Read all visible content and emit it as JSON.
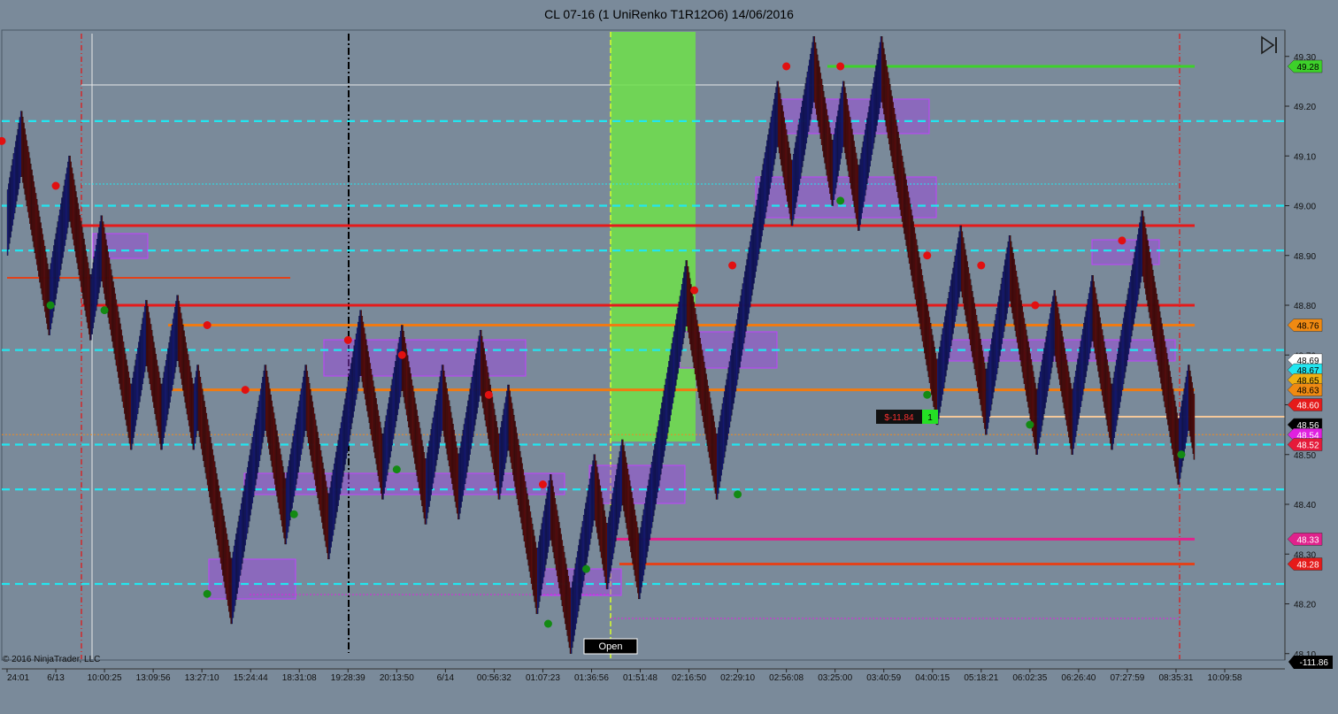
{
  "window_title": "CL 07-16 (1 UniRenko T1R12O6)  14/06/2016",
  "copyright": "© 2016 NinjaTrader, LLC",
  "open_label": "Open",
  "position": {
    "pnl": "$-11.84",
    "qty": "1"
  },
  "pnl_total": "-111.86",
  "colors": {
    "background": "#7a8a9a",
    "up_bar": "#1a1f8c",
    "down_bar": "#6b0f10",
    "swing_high": "#e11010",
    "swing_low": "#138a13",
    "cyan_levels": "#22e6f0",
    "zone": "#a040e6"
  },
  "icons": [
    "play-end-icon"
  ],
  "chart_data": {
    "type": "line",
    "title": "CL 07-16 (1 UniRenko T1R12O6)  14/06/2016",
    "ylim": [
      48.08,
      49.33
    ],
    "y_ticks": [
      "49.30",
      "49.20",
      "49.10",
      "49.00",
      "48.90",
      "48.80",
      "48.70",
      "48.60",
      "48.50",
      "48.40",
      "48.30",
      "48.20",
      "48.10"
    ],
    "x_ticks": [
      "24:01",
      "6/13",
      "10:00:25",
      "13:09:56",
      "13:27:10",
      "15:24:44",
      "18:31:08",
      "19:28:39",
      "20:13:50",
      "6/14",
      "00:56:32",
      "01:07:23",
      "01:36:56",
      "01:51:48",
      "02:16:50",
      "02:29:10",
      "02:56:08",
      "03:25:00",
      "03:40:59",
      "04:00:15",
      "05:18:21",
      "06:02:35",
      "06:26:40",
      "07:27:59",
      "08:35:31",
      "10:09:58"
    ],
    "price_path": [
      48.96,
      49.13,
      48.8,
      49.04,
      48.79,
      48.92,
      48.57,
      48.75,
      48.57,
      48.76,
      48.57,
      48.62,
      48.22,
      48.62,
      48.38,
      48.62,
      48.35,
      48.73,
      48.47,
      48.7,
      48.42,
      48.62,
      48.43,
      48.69,
      48.47,
      48.58,
      48.24,
      48.4,
      48.16,
      48.44,
      48.29,
      48.47,
      48.27,
      48.83,
      48.47,
      48.88,
      49.19,
      49.02,
      49.28,
      49.06,
      49.19,
      49.01,
      49.28,
      48.62,
      48.9,
      48.6,
      48.88,
      48.56,
      48.77,
      48.56,
      48.8,
      48.57,
      48.93,
      48.5,
      48.62,
      48.55
    ],
    "swing_highs": [
      [
        "24:01",
        49.13
      ],
      [
        "6/13",
        49.04
      ],
      [
        "13:27:10",
        48.76
      ],
      [
        "15:24:44",
        48.63
      ],
      [
        "19:28:39",
        48.73
      ],
      [
        "20:13:50",
        48.7
      ],
      [
        "00:56:32",
        48.62
      ],
      [
        "01:07:23",
        48.44
      ],
      [
        "02:16:50",
        48.83
      ],
      [
        "02:29:10",
        48.88
      ],
      [
        "02:56:08",
        49.28
      ],
      [
        "03:25:00",
        49.28
      ],
      [
        "04:00:15",
        48.9
      ],
      [
        "05:18:21",
        48.88
      ],
      [
        "06:02:35",
        48.8
      ],
      [
        "07:27:59",
        48.93
      ]
    ],
    "swing_lows": [
      [
        "6/13",
        48.8
      ],
      [
        "10:00:25",
        48.79
      ],
      [
        "13:27:10",
        48.22
      ],
      [
        "18:31:08",
        48.38
      ],
      [
        "20:13:50",
        48.47
      ],
      [
        "01:07:23",
        48.16
      ],
      [
        "01:36:56",
        48.27
      ],
      [
        "02:29:10",
        48.42
      ],
      [
        "03:25:00",
        49.01
      ],
      [
        "04:00:15",
        48.62
      ],
      [
        "06:02:35",
        48.56
      ],
      [
        "08:35:31",
        48.5
      ]
    ],
    "levels": [
      {
        "price": 49.28,
        "label": "49.28",
        "color": "#3dd12a",
        "style": "solid"
      },
      {
        "price": 49.17,
        "color": "#22e6f0",
        "style": "dashed"
      },
      {
        "price": 49.0,
        "color": "#22e6f0",
        "style": "dashed"
      },
      {
        "price": 48.96,
        "color": "#e51a1a",
        "style": "solid"
      },
      {
        "price": 48.91,
        "color": "#22e6f0",
        "style": "dashed"
      },
      {
        "price": 48.8,
        "color": "#e51a1a",
        "style": "solid"
      },
      {
        "price": 48.76,
        "label": "48.76",
        "color": "#f07a12",
        "style": "solid"
      },
      {
        "price": 48.71,
        "color": "#22e6f0",
        "style": "dashed"
      },
      {
        "price": 48.63,
        "label": "48.63",
        "color": "#f07a12",
        "style": "solid"
      },
      {
        "price": 48.52,
        "color": "#22e6f0",
        "style": "dashed"
      },
      {
        "price": 48.43,
        "color": "#22e6f0",
        "style": "dashed"
      },
      {
        "price": 48.33,
        "label": "48.33",
        "color": "#e0228c",
        "style": "solid"
      },
      {
        "price": 48.28,
        "label": "48.28",
        "color": "#e2421a",
        "style": "solid"
      },
      {
        "price": 48.24,
        "color": "#22e6f0",
        "style": "dashed"
      }
    ],
    "price_markers": [
      {
        "price": 49.28,
        "label": "49.28",
        "bg": "#3dd12a",
        "fg": "#000"
      },
      {
        "price": 48.76,
        "label": "48.76",
        "bg": "#f08a12",
        "fg": "#000"
      },
      {
        "price": 48.69,
        "label": "48.69",
        "bg": "#ffffff",
        "fg": "#000"
      },
      {
        "price": 48.67,
        "label": "48.67",
        "bg": "#22e6f0",
        "fg": "#000"
      },
      {
        "price": 48.65,
        "label": "48.65",
        "bg": "#f0b012",
        "fg": "#000"
      },
      {
        "price": 48.63,
        "label": "48.63",
        "bg": "#f08a12",
        "fg": "#000"
      },
      {
        "price": 48.6,
        "label": "48.60",
        "bg": "#e51a1a",
        "fg": "#fff"
      },
      {
        "price": 48.56,
        "label": "48.56",
        "bg": "#000000",
        "fg": "#fff"
      },
      {
        "price": 48.54,
        "label": "48.54",
        "bg": "#e020e0",
        "fg": "#fff"
      },
      {
        "price": 48.52,
        "label": "48.52",
        "bg": "#e51a3a",
        "fg": "#fff"
      },
      {
        "price": 48.33,
        "label": "48.33",
        "bg": "#e0228c",
        "fg": "#fff"
      },
      {
        "price": 48.28,
        "label": "48.28",
        "bg": "#e51a1a",
        "fg": "#fff"
      }
    ],
    "grid": false
  }
}
